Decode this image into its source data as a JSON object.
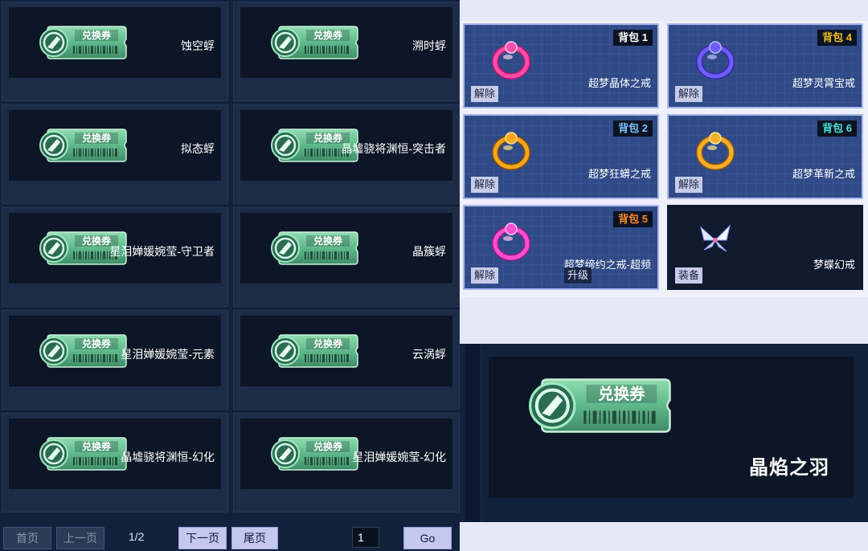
{
  "voucher_label": "兑换券",
  "voucher_list": [
    {
      "name": "蚀空蜉"
    },
    {
      "name": "溯时蜉"
    },
    {
      "name": "拟态蜉"
    },
    {
      "name": "晶墟骁将渊恒-突击者"
    },
    {
      "name": "星泪婵媛婉莹-守卫者"
    },
    {
      "name": "晶簇蜉"
    },
    {
      "name": "星泪婵媛婉莹-元素"
    },
    {
      "name": "云涡蜉"
    },
    {
      "name": "晶墟骁将渊恒-幻化"
    },
    {
      "name": "星泪婵媛婉莹-幻化"
    }
  ],
  "pagination": {
    "first": "首页",
    "prev": "上一页",
    "indicator": "1/2",
    "next": "下一页",
    "last": "尾页",
    "page_input": "1",
    "go": "Go"
  },
  "equipment": [
    {
      "name": "超梦晶体之戒",
      "bag": "背包 1",
      "bag_color": "#ffffff",
      "icon": "pink-crystal-ring-icon",
      "buttons": [
        "解除"
      ]
    },
    {
      "name": "超梦灵霄宝戒",
      "bag": "背包 4",
      "bag_color": "#f2c11b",
      "icon": "purple-gem-ring-icon",
      "buttons": [
        "解除"
      ]
    },
    {
      "name": "超梦狂蟒之戒",
      "bag": "背包 2",
      "bag_color": "#7fc3ff",
      "icon": "gold-serpent-ring-icon",
      "buttons": [
        "解除"
      ]
    },
    {
      "name": "超梦革新之戒",
      "bag": "背包 6",
      "bag_color": "#49e3d6",
      "icon": "gold-ring-icon",
      "buttons": [
        "解除"
      ]
    },
    {
      "name": "超梦缔约之戒-超频",
      "bag": "背包 5",
      "bag_color": "#ff8a2a",
      "icon": "magenta-band-ring-icon",
      "buttons": [
        "解除",
        "升级"
      ]
    },
    {
      "name": "梦蝶幻戒",
      "bag": "",
      "bag_color": "",
      "icon": "crystal-butterfly-icon",
      "buttons": [
        "装备"
      ]
    }
  ],
  "detail": {
    "name": "晶焰之羽",
    "voucher_label": "兑换券"
  },
  "colors": {
    "voucher_green": "#5fb88a",
    "slot_blue": "#2f4a86",
    "slot_border": "#aab6ec"
  }
}
